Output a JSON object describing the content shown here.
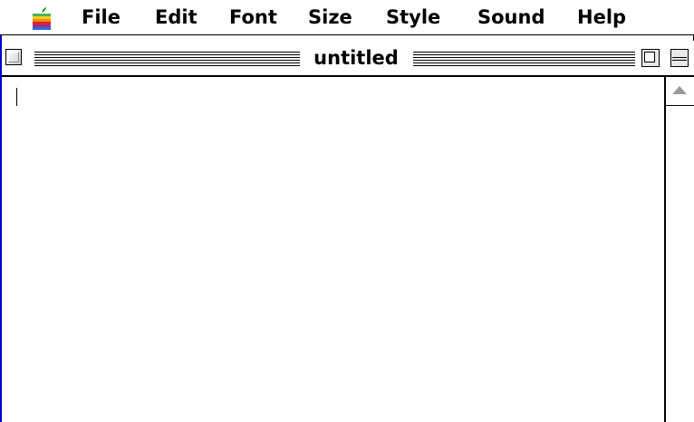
{
  "menubar": {
    "apple_icon": "apple-rainbow-icon",
    "items": [
      {
        "label": "File"
      },
      {
        "label": "Edit"
      },
      {
        "label": "Font"
      },
      {
        "label": "Size"
      },
      {
        "label": "Style"
      },
      {
        "label": "Sound"
      },
      {
        "label": "Help"
      }
    ]
  },
  "window": {
    "title": "untitled",
    "close_icon": "close-box-icon",
    "zoom_icon": "zoom-box-icon",
    "collapse_icon": "collapse-box-icon",
    "scroll_up_icon": "scroll-up-arrow-icon",
    "content": ""
  },
  "colors": {
    "window_frame_left": "#0000cc",
    "menubar_background": "#ffffff"
  }
}
